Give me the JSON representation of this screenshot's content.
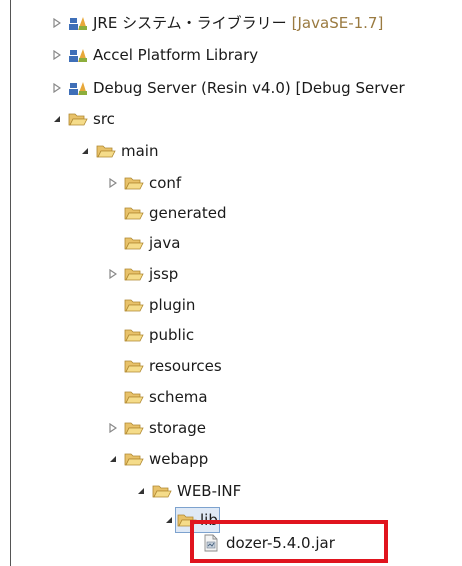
{
  "tree": {
    "libraries": [
      {
        "label": "JRE システム・ライブラリー",
        "decoration": "[JavaSE-1.7]",
        "icon": "library-icon"
      },
      {
        "label": "Accel Platform Library",
        "decoration": "",
        "icon": "library-icon"
      },
      {
        "label": "Debug Server (Resin v4.0) [Debug Server",
        "decoration": "",
        "icon": "library-icon"
      }
    ],
    "src": "src",
    "main": "main",
    "main_children": [
      "conf",
      "generated",
      "java",
      "jssp",
      "plugin",
      "public",
      "resources",
      "schema",
      "storage"
    ],
    "webapp": "webapp",
    "web_inf": "WEB-INF",
    "lib": "lib",
    "jar": "dozer-5.4.0.jar"
  },
  "colors": {
    "highlight_border": "#e0141e",
    "folder": "#e8c26a",
    "library": "#3f6fb8",
    "decoration_text": "#9a7a40",
    "selection": "#dfe9f6"
  }
}
